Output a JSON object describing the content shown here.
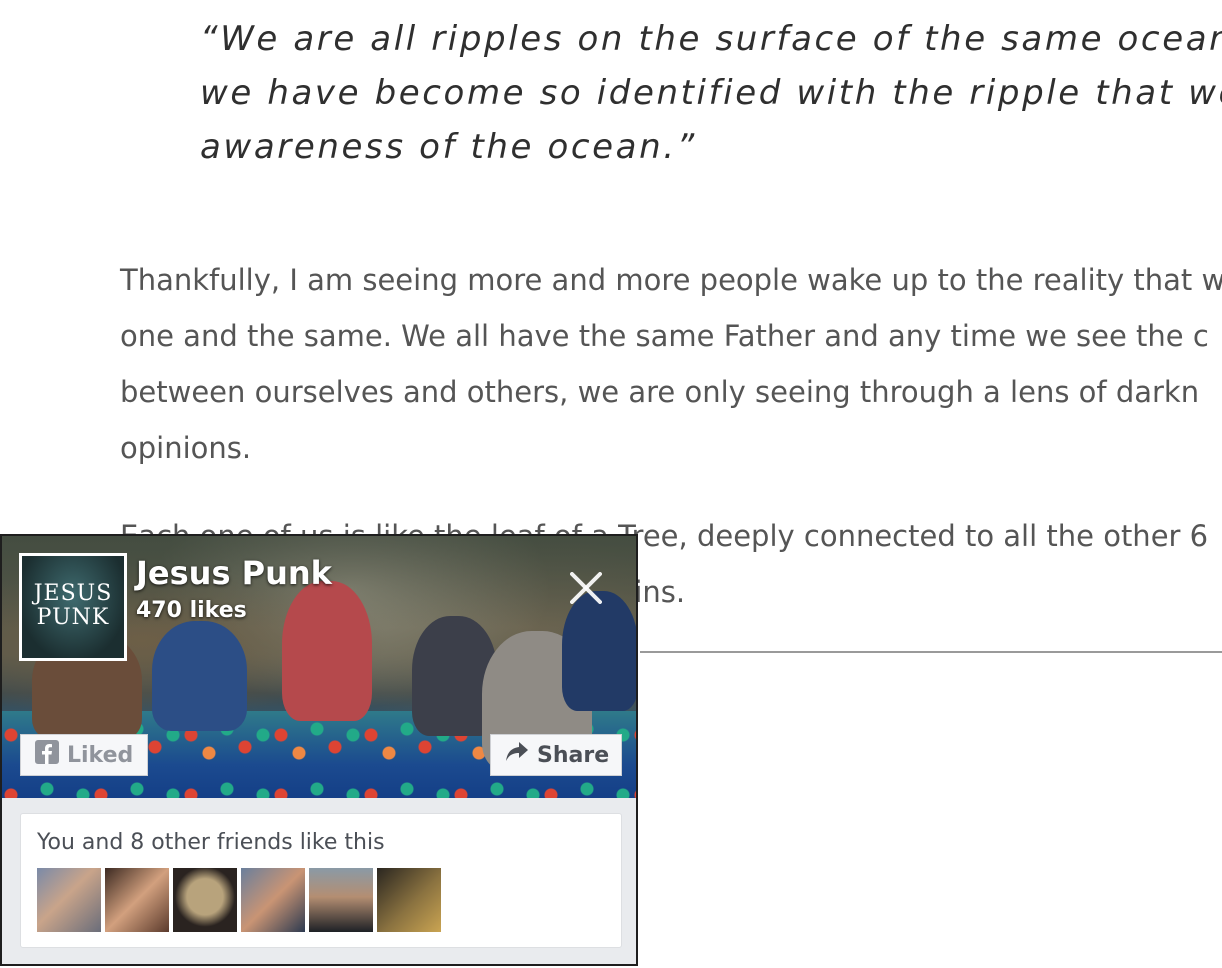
{
  "quote": {
    "lines": [
      "“We are all ripples on the surface of the same ocean. The",
      "we have become so identified with the ripple that we have",
      "awareness of the ocean.”"
    ]
  },
  "paragraphs": {
    "p1": [
      "Thankfully, I am seeing more and more people wake up to the reality that w",
      "one and the same. We all have the same Father and any time we see the c",
      "between ourselves and others, we are only seeing through a lens of darkn",
      "opinions."
    ],
    "p2": [
      "Each one of us is like the leaf of a Tree, deeply connected to all the other 6",
      "same blood running through our veins."
    ]
  },
  "fb_widget": {
    "page_name": "Jesus Punk",
    "likes": "470 likes",
    "avatar_logo": "JESUS PUNK",
    "liked_label": "Liked",
    "share_label": "Share",
    "friends_text": "You and 8 other friends like this",
    "friend_count_shown": 6,
    "colors": {
      "button_text": "#4b4f56",
      "liked_text": "#90949c",
      "card_border": "#dddfe2",
      "widget_bg": "#e9ebee"
    },
    "icons": [
      "facebook-f-icon",
      "share-arrow-icon",
      "close-icon"
    ]
  }
}
